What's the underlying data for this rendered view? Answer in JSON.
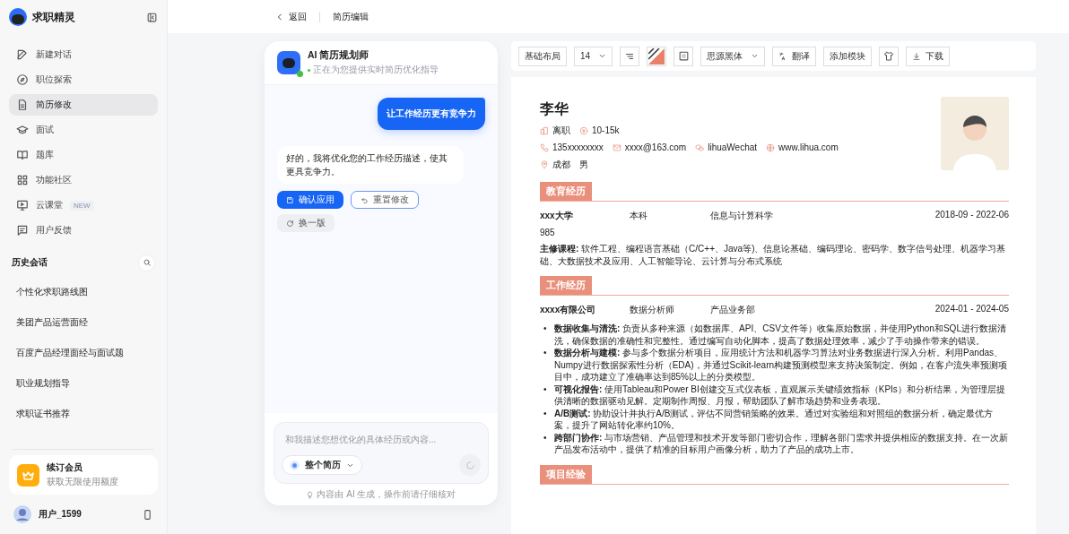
{
  "sidebar": {
    "brand": "求职精灵",
    "nav": [
      {
        "label": "新建对话",
        "selected": false
      },
      {
        "label": "职位探索",
        "selected": false
      },
      {
        "label": "简历修改",
        "selected": true
      },
      {
        "label": "面试",
        "selected": false
      },
      {
        "label": "题库",
        "selected": false
      },
      {
        "label": "功能社区",
        "selected": false
      },
      {
        "label": "云课堂",
        "selected": false,
        "badge": "NEW"
      },
      {
        "label": "用户反馈",
        "selected": false
      }
    ],
    "history_title": "历史会话",
    "history": [
      "个性化求职路线图",
      "美团产品运营面经",
      "百度产品经理面经与面试题",
      "职业规划指导",
      "求职证书推荐"
    ],
    "membership": {
      "title": "续订会员",
      "subtitle": "获取无限使用额度"
    },
    "user": {
      "name": "用户_1599"
    }
  },
  "topbar": {
    "back": "返回",
    "title": "简历编辑"
  },
  "chat": {
    "assistant": {
      "name": "AI 简历规划师",
      "status": "正在为您提供实时简历优化指导",
      "online": true
    },
    "messages": [
      {
        "kind": "user",
        "text": "让工作经历更有竞争力"
      },
      {
        "kind": "assistant",
        "text": "好的，我将优化您的工作经历描述，使其更具竞争力。"
      }
    ],
    "actions": [
      {
        "label": "确认应用",
        "kind": "primary"
      },
      {
        "label": "重置修改",
        "kind": "outline"
      },
      {
        "label": "换一版",
        "kind": "ghost"
      }
    ],
    "input": {
      "placeholder": "和我描述您想优化的具体经历或内容...",
      "scope": "整个简历"
    },
    "disclaimer": "内容由 AI 生成，操作前请仔细核对"
  },
  "toolbar": [
    {
      "kind": "text",
      "label": "基础布局"
    },
    {
      "kind": "select",
      "label": "14"
    },
    {
      "kind": "icon"
    },
    {
      "kind": "icon"
    },
    {
      "kind": "icon"
    },
    {
      "kind": "select",
      "label": "思源黑体"
    },
    {
      "kind": "icon_text",
      "label": "翻译"
    },
    {
      "kind": "text",
      "label": "添加模块"
    },
    {
      "kind": "icon"
    },
    {
      "kind": "icon_text",
      "label": "下载"
    }
  ],
  "resume": {
    "name": "李华",
    "status": "离职",
    "salary": "10-15k",
    "contacts": [
      "135xxxxxxxx",
      "xxxx@163.com",
      "lihuaWechat",
      "www.lihua.com"
    ],
    "city": "成都",
    "gender": "男",
    "sections": [
      {
        "title": "教育经历",
        "entries": [
          {
            "col_1": "xxx大学",
            "col_2": "本科",
            "col_3": "信息与计算科学",
            "dates": "2018-09 - 2022-06",
            "note": "985",
            "detail": "**主修课程:** 软件工程、编程语言基础（C/C++、Java等)、信息论基础、编码理论、密码学、数字信号处理、机器学习基础、大数据技术及应用、人工智能导论、云计算与分布式系统"
          }
        ]
      },
      {
        "title": "工作经历",
        "entries": [
          {
            "col_1": "xxxx有限公司",
            "col_2": "数据分析师",
            "col_3": "产品业务部",
            "dates": "2024-01 - 2024-05",
            "bullets": [
              {
                "marker": "•",
                "text": "**数据收集与清洗:** 负责从多种来源（如数据库、API、CSV文件等）收集原始数据，并使用Python和SQL进行数据清洗，确保数据的准确性和完整性。通过编写自动化脚本，提高了数据处理效率，减少了手动操作带来的错误。"
              },
              {
                "marker": "•",
                "text": "**数据分析与建模:** 参与多个数据分析项目，应用统计方法和机器学习算法对业务数据进行深入分析。利用Pandas、Numpy进行数据探索性分析（EDA)，并通过Scikit-learn构建预测模型来支持决策制定。例如，在客户流失率预测项目中，成功建立了准确率达到85%以上的分类模型。"
              },
              {
                "marker": "•",
                "text": "**可视化报告:** 使用Tableau和Power BI创建交互式仪表板，直观展示关键绩效指标（KPIs）和分析结果，为管理层提供清晰的数据驱动见解。定期制作周报、月报，帮助团队了解市场趋势和业务表现。"
              },
              {
                "marker": "•",
                "text": "**A/B测试:** 协助设计并执行A/B测试，评估不同营销策略的效果。通过对实验组和对照组的数据分析，确定最优方案，提升了网站转化率约10%。"
              },
              {
                "marker": "•",
                "text": "**跨部门协作:** 与市场营销、产品管理和技术开发等部门密切合作，理解各部门需求并提供相应的数据支持。在一次新产品发布活动中，提供了精准的目标用户画像分析，助力了产品的成功上市。"
              }
            ]
          }
        ]
      },
      {
        "title": "项目经验"
      }
    ]
  }
}
